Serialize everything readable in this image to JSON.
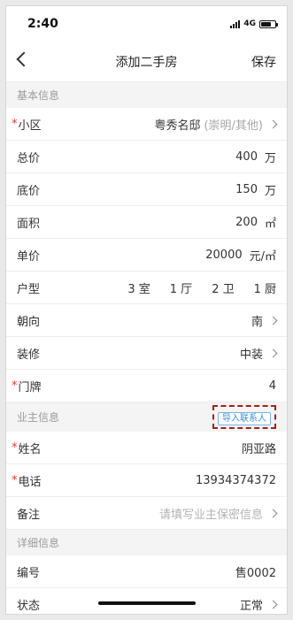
{
  "status_bar": {
    "time": "2:40",
    "network": "4G",
    "battery_level": 0.72
  },
  "nav": {
    "title": "添加二手房",
    "save_label": "保存"
  },
  "sections": {
    "basic": "基本信息",
    "owner": "业主信息",
    "detail": "详细信息"
  },
  "basic_rows": {
    "community": {
      "label": "小区",
      "value": "粤秀名邸",
      "sub": "(崇明/其他)"
    },
    "total_price": {
      "label": "总价",
      "value": "400",
      "unit": "万"
    },
    "floor_price": {
      "label": "底价",
      "value": "150",
      "unit": "万"
    },
    "area": {
      "label": "面积",
      "value": "200",
      "unit": "㎡"
    },
    "unit_price": {
      "label": "单价",
      "value": "20000",
      "unit": "元/㎡"
    },
    "layout": {
      "label": "户型",
      "rooms": "3 室",
      "halls": "1 厅",
      "baths": "2 卫",
      "kitchens": "1 厨"
    },
    "orientation": {
      "label": "朝向",
      "value": "南"
    },
    "decoration": {
      "label": "装修",
      "value": "中装"
    },
    "door_no": {
      "label": "门牌",
      "value": "4"
    }
  },
  "owner": {
    "import_label": "导入联系人",
    "name": {
      "label": "姓名",
      "value": "阴亚路"
    },
    "phone": {
      "label": "电话",
      "value": "13934374372"
    },
    "note": {
      "label": "备注",
      "placeholder": "请填写业主保密信息"
    }
  },
  "detail_rows": {
    "code": {
      "label": "编号",
      "value": "售0002"
    },
    "state": {
      "label": "状态",
      "value": "正常"
    }
  },
  "required_mark": "*"
}
